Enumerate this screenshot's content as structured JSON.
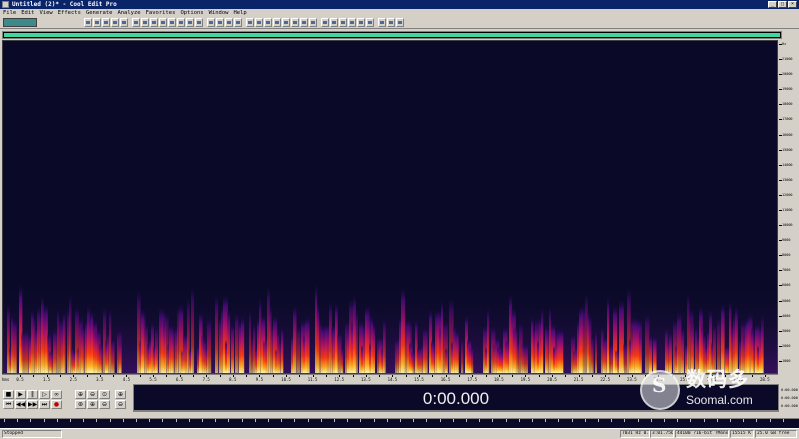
{
  "window": {
    "title": "Untitled (2)* - Cool Edit Pro"
  },
  "menu": [
    "File",
    "Edit",
    "View",
    "Effects",
    "Generate",
    "Analyze",
    "Favorites",
    "Options",
    "Window",
    "Help"
  ],
  "spectrogram": {
    "axis_unit": "hms",
    "x_ticks": [
      "0.5",
      "1.0",
      "1.5",
      "2.0",
      "2.5",
      "3.0",
      "3.5",
      "4.0",
      "4.5",
      "5.0",
      "5.5",
      "6.0",
      "6.5",
      "7.0",
      "7.5",
      "8.0",
      "8.5",
      "9.0",
      "9.5",
      "10.0",
      "10.5",
      "11.0",
      "11.5",
      "12.0",
      "12.5",
      "13.0",
      "13.5",
      "14.0",
      "14.5",
      "15.0",
      "15.5",
      "16.0",
      "16.5",
      "17.0",
      "17.5",
      "18.0",
      "18.5",
      "19.0",
      "19.5",
      "20.0",
      "20.5",
      "21.0",
      "21.5",
      "22.0",
      "22.5",
      "23.0",
      "23.5",
      "24.0",
      "24.5",
      "25.0",
      "25.5",
      "26.0",
      "26.5",
      "27.0",
      "27.5",
      "28.0",
      "28.5"
    ],
    "y_ticks": [
      "Hz",
      "21000",
      "20000",
      "19000",
      "18000",
      "17000",
      "16000",
      "15000",
      "14000",
      "13000",
      "12000",
      "11000",
      "10000",
      "9000",
      "8000",
      "7000",
      "6000",
      "5000",
      "4000",
      "3000",
      "2000",
      "1000"
    ]
  },
  "transport": {
    "row1": [
      "stop",
      "play",
      "pause",
      "play-to-end",
      "loop"
    ],
    "row2": [
      "go-to-start",
      "rewind",
      "fast-forward",
      "go-to-end",
      "record"
    ],
    "zoom": [
      "zoom-in-h",
      "zoom-out-h",
      "zoom-full",
      "zoom-sel",
      "zoom-in-v",
      "zoom-out-v"
    ]
  },
  "time_display": "0:00.000",
  "selection_panel": [
    "0:00.000",
    "0:00.000",
    "0:00.000"
  ],
  "status": {
    "state": "Stopped",
    "format": "7031 Hz 0.0db",
    "pos": "3:01.756",
    "samples": "44100 ?16-bit ?Mono",
    "size": "15515 K",
    "free": "25.0 GB free"
  },
  "watermark": {
    "cn": "数码多",
    "en": "Soomal.com"
  },
  "colors": {
    "spectrogram_bg": "#0a0a28",
    "overview_bar": "#3fd6a0",
    "titlebar": "#0a246a"
  }
}
